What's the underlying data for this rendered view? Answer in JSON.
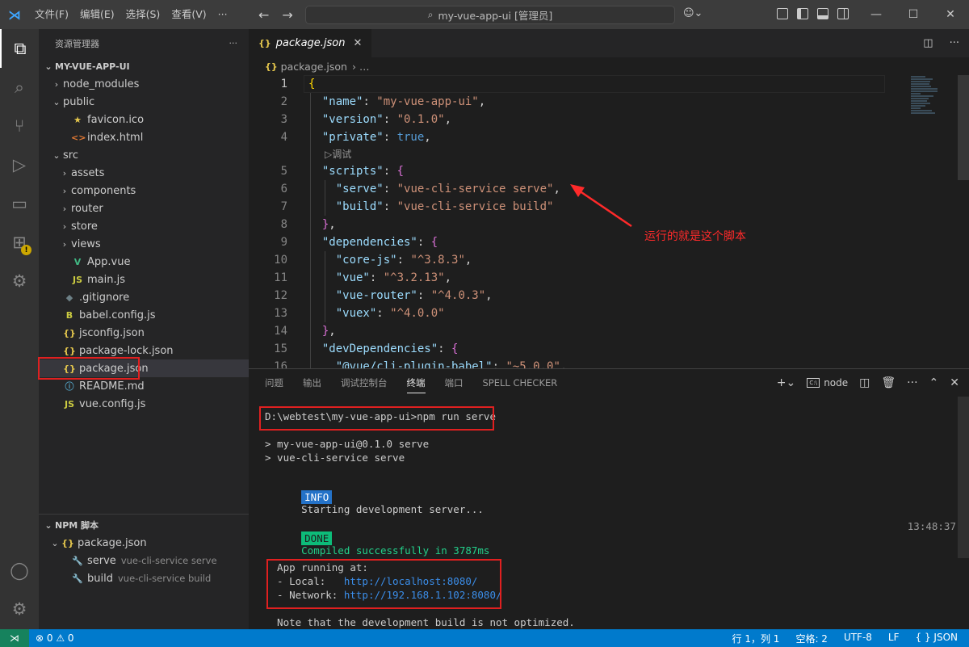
{
  "titlebar": {
    "menus": [
      "文件(F)",
      "编辑(E)",
      "选择(S)",
      "查看(V)",
      "···"
    ],
    "search_text": "my-vue-app-ui [管理员]",
    "window_buttons": [
      "—",
      "☐",
      "✕"
    ]
  },
  "explorer": {
    "title": "资源管理器",
    "more": "···",
    "root": "MY-VUE-APP-UI",
    "items": [
      {
        "label": "node_modules",
        "indent": 1,
        "chevron": "›",
        "icon": "",
        "icon_color": ""
      },
      {
        "label": "public",
        "indent": 1,
        "chevron": "⌄",
        "icon": "",
        "icon_color": ""
      },
      {
        "label": "favicon.ico",
        "indent": 2,
        "chevron": "",
        "icon": "★",
        "icon_color": "#e6c84d"
      },
      {
        "label": "index.html",
        "indent": 2,
        "chevron": "",
        "icon": "<>",
        "icon_color": "#e37933"
      },
      {
        "label": "src",
        "indent": 1,
        "chevron": "⌄",
        "icon": "",
        "icon_color": ""
      },
      {
        "label": "assets",
        "indent": 2,
        "chevron": "›",
        "icon": "",
        "icon_color": ""
      },
      {
        "label": "components",
        "indent": 2,
        "chevron": "›",
        "icon": "",
        "icon_color": ""
      },
      {
        "label": "router",
        "indent": 2,
        "chevron": "›",
        "icon": "",
        "icon_color": ""
      },
      {
        "label": "store",
        "indent": 2,
        "chevron": "›",
        "icon": "",
        "icon_color": ""
      },
      {
        "label": "views",
        "indent": 2,
        "chevron": "›",
        "icon": "",
        "icon_color": ""
      },
      {
        "label": "App.vue",
        "indent": 2,
        "chevron": "",
        "icon": "V",
        "icon_color": "#41b883"
      },
      {
        "label": "main.js",
        "indent": 2,
        "chevron": "",
        "icon": "JS",
        "icon_color": "#cbcb41"
      },
      {
        "label": ".gitignore",
        "indent": 1,
        "chevron": "",
        "icon": "◆",
        "icon_color": "#6d8086"
      },
      {
        "label": "babel.config.js",
        "indent": 1,
        "chevron": "",
        "icon": "B",
        "icon_color": "#cbcb41"
      },
      {
        "label": "jsconfig.json",
        "indent": 1,
        "chevron": "",
        "icon": "{}",
        "icon_color": "#e6c84d"
      },
      {
        "label": "package-lock.json",
        "indent": 1,
        "chevron": "",
        "icon": "{}",
        "icon_color": "#e6c84d"
      },
      {
        "label": "package.json",
        "indent": 1,
        "chevron": "",
        "icon": "{}",
        "icon_color": "#e6c84d",
        "selected": true
      },
      {
        "label": "README.md",
        "indent": 1,
        "chevron": "",
        "icon": "ⓘ",
        "icon_color": "#519aba"
      },
      {
        "label": "vue.config.js",
        "indent": 1,
        "chevron": "",
        "icon": "JS",
        "icon_color": "#cbcb41"
      }
    ]
  },
  "npm_scripts": {
    "title": "NPM 脚本",
    "file": "package.json",
    "scripts": [
      {
        "name": "serve",
        "command": "vue-cli-service serve"
      },
      {
        "name": "build",
        "command": "vue-cli-service build"
      }
    ]
  },
  "editor": {
    "tab": "package.json",
    "breadcrumb_file": "package.json",
    "breadcrumb_more": "›  …",
    "codelens": "▷调试",
    "annotation": "运行的就是这个脚本",
    "lines": [
      {
        "n": "1",
        "html": "<span class='br1'>{</span>"
      },
      {
        "n": "2",
        "html": "  <span class='k'>\"name\"</span><span class='p'>: </span><span class='s'>\"my-vue-app-ui\"</span><span class='p'>,</span>"
      },
      {
        "n": "3",
        "html": "  <span class='k'>\"version\"</span><span class='p'>: </span><span class='s'>\"0.1.0\"</span><span class='p'>,</span>"
      },
      {
        "n": "4",
        "html": "  <span class='k'>\"private\"</span><span class='p'>: </span><span class='b'>true</span><span class='p'>,</span>"
      },
      {
        "n": "5",
        "html": "  <span class='k'>\"scripts\"</span><span class='p'>: </span><span class='br2'>{</span>"
      },
      {
        "n": "6",
        "html": "    <span class='k'>\"serve\"</span><span class='p'>: </span><span class='s'>\"vue-cli-service serve\"</span><span class='p'>,</span>"
      },
      {
        "n": "7",
        "html": "    <span class='k'>\"build\"</span><span class='p'>: </span><span class='s'>\"vue-cli-service build\"</span>"
      },
      {
        "n": "8",
        "html": "  <span class='br2'>}</span><span class='p'>,</span>"
      },
      {
        "n": "9",
        "html": "  <span class='k'>\"dependencies\"</span><span class='p'>: </span><span class='br2'>{</span>"
      },
      {
        "n": "10",
        "html": "    <span class='k'>\"core-js\"</span><span class='p'>: </span><span class='s'>\"^3.8.3\"</span><span class='p'>,</span>"
      },
      {
        "n": "11",
        "html": "    <span class='k'>\"vue\"</span><span class='p'>: </span><span class='s'>\"^3.2.13\"</span><span class='p'>,</span>"
      },
      {
        "n": "12",
        "html": "    <span class='k'>\"vue-router\"</span><span class='p'>: </span><span class='s'>\"^4.0.3\"</span><span class='p'>,</span>"
      },
      {
        "n": "13",
        "html": "    <span class='k'>\"vuex\"</span><span class='p'>: </span><span class='s'>\"^4.0.0\"</span>"
      },
      {
        "n": "14",
        "html": "  <span class='br2'>}</span><span class='p'>,</span>"
      },
      {
        "n": "15",
        "html": "  <span class='k'>\"devDependencies\"</span><span class='p'>: </span><span class='br2'>{</span>"
      },
      {
        "n": "16",
        "html": "    <span class='k'>\"@vue/cli-plugin-babel\"</span><span class='p'>: </span><span class='s'>\"~5.0.0\"</span><span class='p'>,</span>"
      }
    ]
  },
  "panel": {
    "tabs": [
      "问题",
      "输出",
      "调试控制台",
      "终端",
      "端口",
      "SPELL CHECKER"
    ],
    "active_tab": "终端",
    "terminal_name": "node",
    "terminal": {
      "prompt": "D:\\webtest\\my-vue-app-ui>npm run serve",
      "line1": "> my-vue-app-ui@0.1.0 serve",
      "line2": "> vue-cli-service serve",
      "info_badge": "INFO",
      "info_text": "Starting development server...",
      "done_badge": "DONE",
      "done_text": "Compiled successfully in 3787ms",
      "timestamp": "13:48:37",
      "app_running": "  App running at:",
      "local_label": "  - Local:   ",
      "local_url": "http://localhost:8080/",
      "network_label": "  - Network: ",
      "network_url": "http://192.168.1.102:8080/",
      "note": "  Note that the development build is not optimized."
    }
  },
  "statusbar": {
    "problems": "⊗ 0 ⚠ 0",
    "position": "行 1，列 1",
    "spaces": "空格: 2",
    "encoding": "UTF-8",
    "eol": "LF",
    "language": "{ } JSON"
  }
}
